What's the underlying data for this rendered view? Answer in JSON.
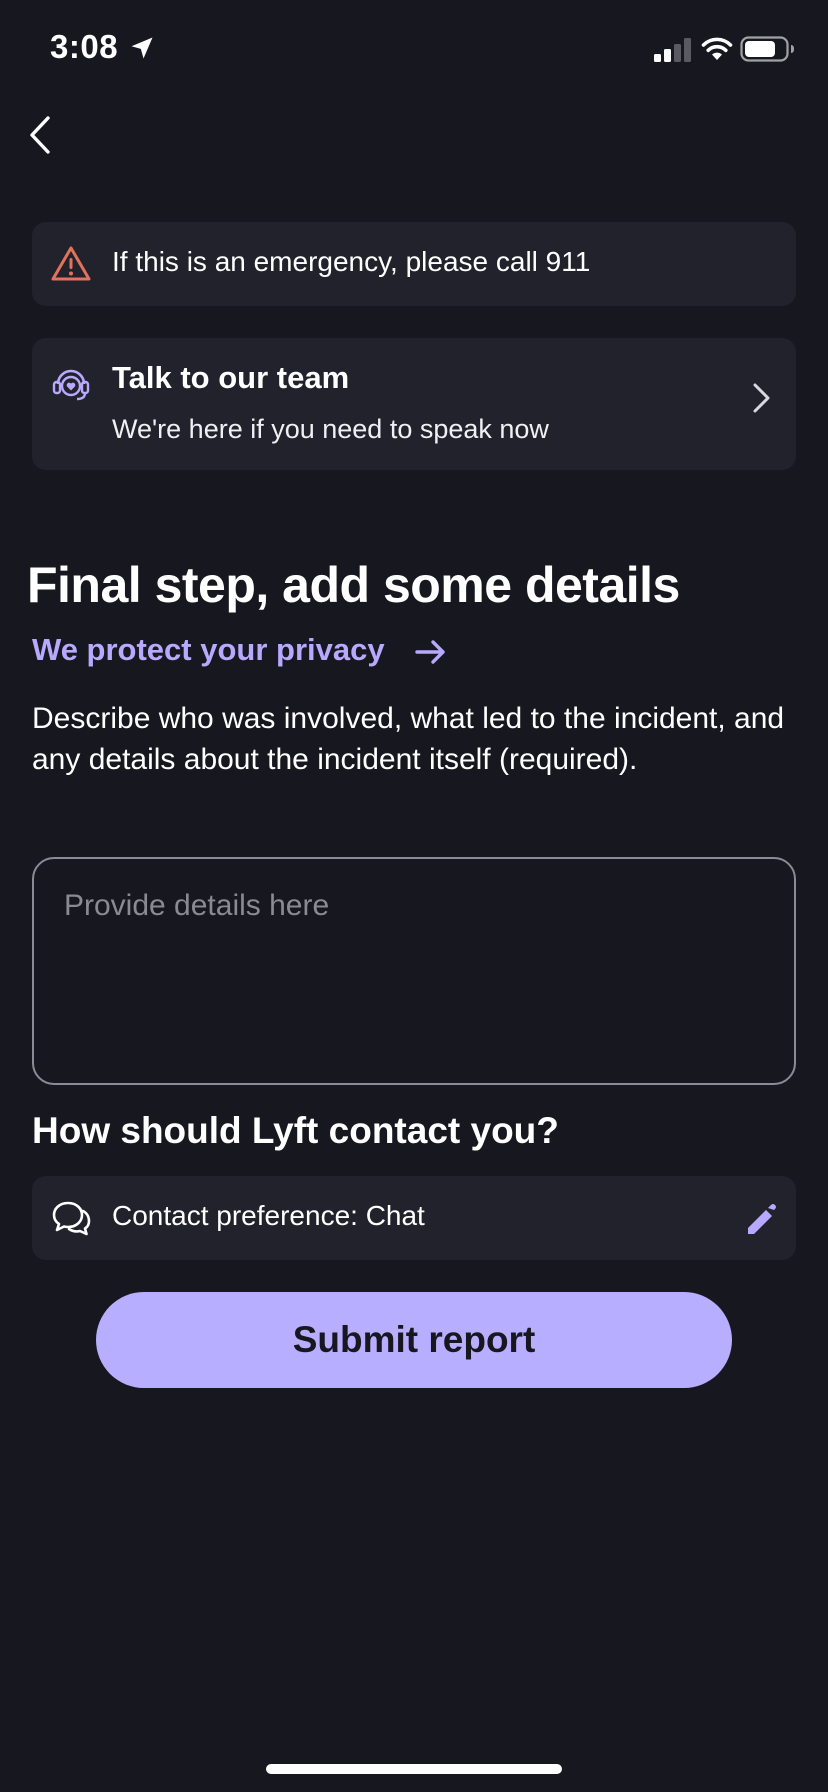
{
  "status_bar": {
    "time": "3:08",
    "location_icon": "location-arrow-icon",
    "signal_icon": "cellular-signal-icon",
    "wifi_icon": "wifi-icon",
    "battery_icon": "battery-icon"
  },
  "nav": {
    "back_icon": "chevron-left-icon"
  },
  "emergency_banner": {
    "icon": "warning-triangle-icon",
    "text": "If this is an emergency, please call 911",
    "icon_color": "#e0735c"
  },
  "team_card": {
    "icon": "support-headset-icon",
    "title": "Talk to our team",
    "subtitle": "We're here if you need to speak now",
    "chevron_icon": "chevron-right-icon"
  },
  "main": {
    "heading": "Final step, add some details",
    "privacy_link": "We protect your privacy",
    "privacy_arrow_icon": "arrow-right-icon",
    "description": "Describe who was involved, what led to the incident, and any details about the incident itself (required).",
    "details_input": {
      "value": "",
      "placeholder": "Provide details here"
    }
  },
  "contact": {
    "heading": "How should Lyft contact you?",
    "icon": "chat-bubbles-icon",
    "preference_text": "Contact preference: Chat",
    "edit_icon": "pencil-icon"
  },
  "submit": {
    "label": "Submit report"
  },
  "colors": {
    "background": "#17171f",
    "card": "#22222c",
    "accent": "#b8a9ff",
    "button": "#b8aeff",
    "warning": "#e0735c"
  }
}
